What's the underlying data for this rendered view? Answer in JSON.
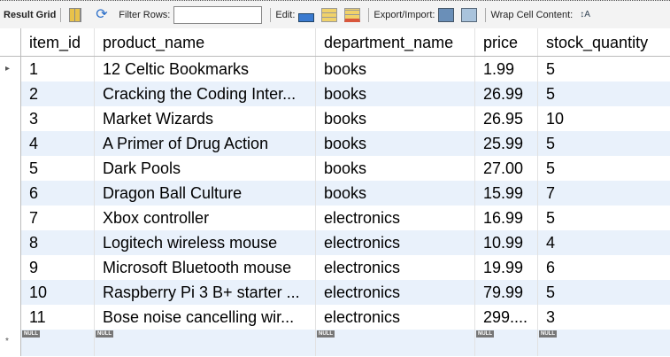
{
  "toolbar": {
    "result_grid": "Result Grid",
    "filter_rows": "Filter Rows:",
    "filter_value": "",
    "edit": "Edit:",
    "export_import": "Export/Import:",
    "wrap_cell": "Wrap Cell Content:"
  },
  "columns": [
    "item_id",
    "product_name",
    "department_name",
    "price",
    "stock_quantity"
  ],
  "rows": [
    [
      "1",
      "12 Celtic Bookmarks",
      "books",
      "1.99",
      "5"
    ],
    [
      "2",
      "Cracking the Coding Inter...",
      "books",
      "26.99",
      "5"
    ],
    [
      "3",
      "Market Wizards",
      "books",
      "26.95",
      "10"
    ],
    [
      "4",
      "A Primer of Drug Action",
      "books",
      "25.99",
      "5"
    ],
    [
      "5",
      "Dark Pools",
      "books",
      "27.00",
      "5"
    ],
    [
      "6",
      "Dragon Ball Culture",
      "books",
      "15.99",
      "7"
    ],
    [
      "7",
      "Xbox controller",
      "electronics",
      "16.99",
      "5"
    ],
    [
      "8",
      "Logitech wireless mouse",
      "electronics",
      "10.99",
      "4"
    ],
    [
      "9",
      "Microsoft Bluetooth mouse",
      "electronics",
      "19.99",
      "6"
    ],
    [
      "10",
      "Raspberry Pi 3 B+ starter ...",
      "electronics",
      "79.99",
      "5"
    ],
    [
      "11",
      "Bose noise cancelling wir...",
      "electronics",
      "299....",
      "3"
    ]
  ],
  "null_label": "NULL",
  "new_row_marker": "*",
  "current_row_marker": "▸"
}
